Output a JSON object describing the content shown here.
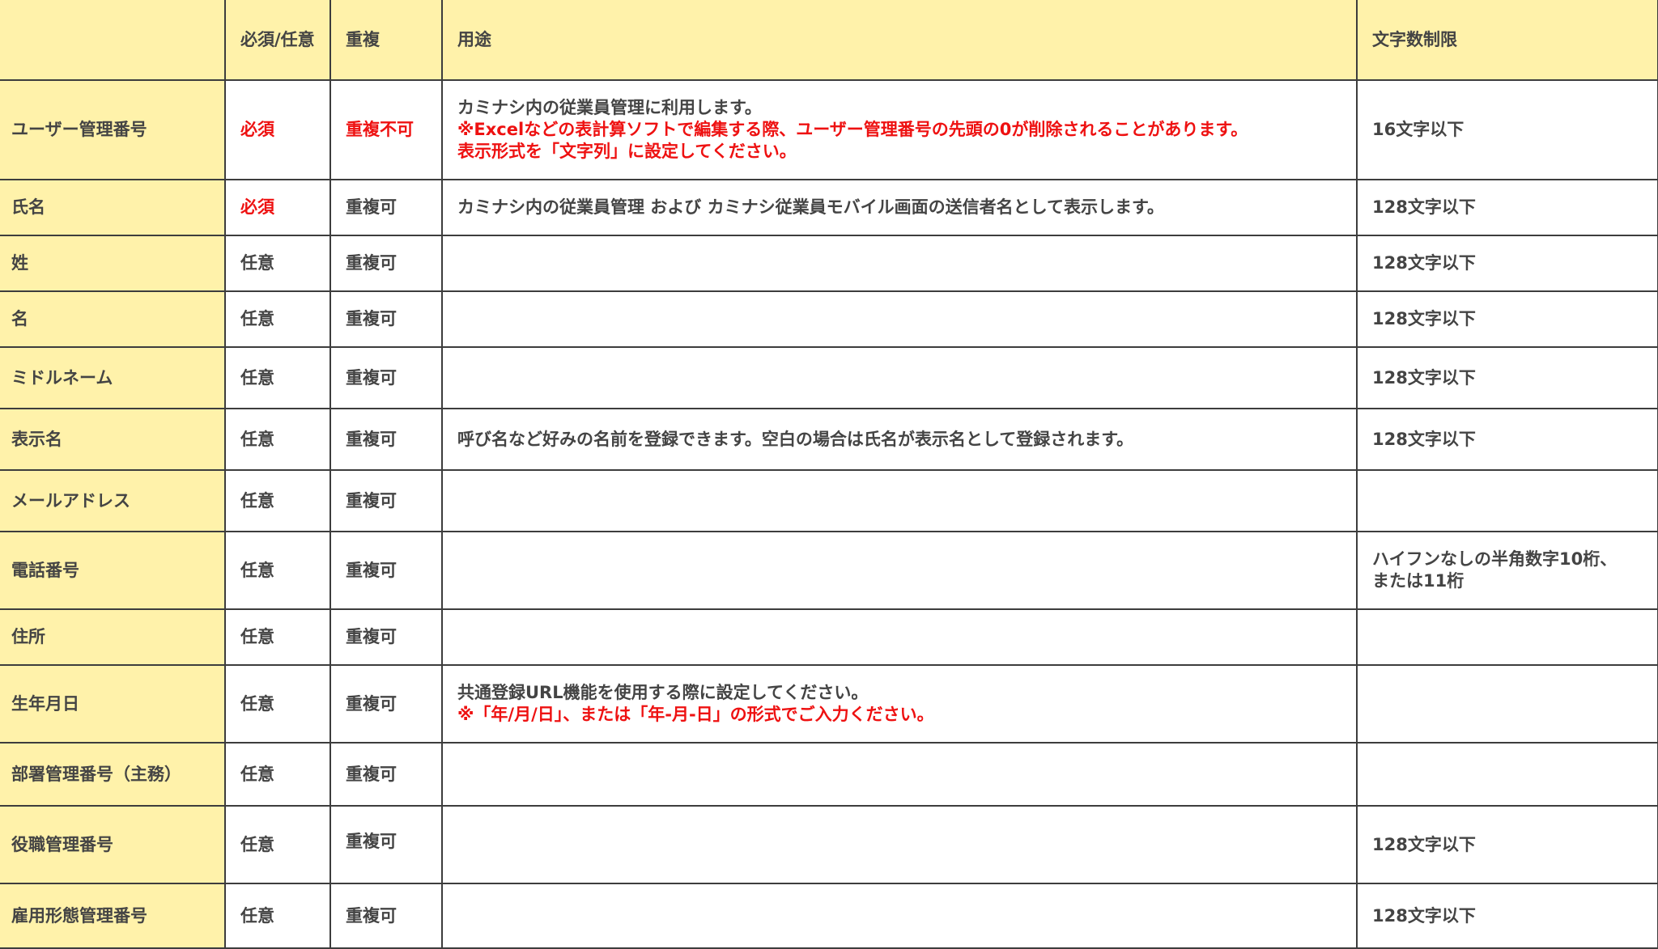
{
  "header": {
    "field": "",
    "required": "必須/任意",
    "duplicate": "重複",
    "purpose": "用途",
    "limit": "文字数制限"
  },
  "rows": [
    {
      "field": "ユーザー管理番号",
      "required": "必須",
      "duplicate": "重複不可",
      "purpose": "カミナシ内の従業員管理に利用します。",
      "purpose_note": "※Excelなどの表計算ソフトで編集する際、ユーザー管理番号の先頭の0が削除されることがあります。",
      "purpose_note2": "表示形式を「文字列」に設定してください。",
      "limit": "16文字以下"
    },
    {
      "field": "氏名",
      "required": "必須",
      "duplicate": "重複可",
      "purpose": "カミナシ内の従業員管理 および カミナシ従業員モバイル画面の送信者名として表示します。",
      "limit": "128文字以下"
    },
    {
      "field": "姓",
      "required": "任意",
      "duplicate": "重複可",
      "purpose": "",
      "limit": "128文字以下"
    },
    {
      "field": "名",
      "required": "任意",
      "duplicate": "重複可",
      "purpose": "",
      "limit": "128文字以下"
    },
    {
      "field": "ミドルネーム",
      "required": "任意",
      "duplicate": "重複可",
      "purpose": "",
      "limit": "128文字以下"
    },
    {
      "field": "表示名",
      "required": "任意",
      "duplicate": "重複可",
      "purpose": "呼び名など好みの名前を登録できます。空白の場合は氏名が表示名として登録されます。",
      "limit": "128文字以下"
    },
    {
      "field": "メールアドレス",
      "required": "任意",
      "duplicate": "重複可",
      "purpose": "",
      "limit": ""
    },
    {
      "field": "電話番号",
      "required": "任意",
      "duplicate": "重複可",
      "purpose": "",
      "limit": "ハイフンなしの半角数字10桁、",
      "limit2": "または11桁"
    },
    {
      "field": "住所",
      "required": "任意",
      "duplicate": "重複可",
      "purpose": "",
      "limit": ""
    },
    {
      "field": "生年月日",
      "required": "任意",
      "duplicate": "重複可",
      "purpose": "共通登録URL機能を使用する際に設定してください。",
      "purpose_note": "※「年/月/日」、または「年-月-日」の形式でご入力ください。",
      "limit": ""
    },
    {
      "field": "部署管理番号（主務）",
      "required": "任意",
      "duplicate": "重複可",
      "purpose": "",
      "limit": ""
    },
    {
      "field": "役職管理番号",
      "required": "任意",
      "duplicate": "重複可",
      "purpose": "",
      "limit": "128文字以下"
    },
    {
      "field": "雇用形態管理番号",
      "required": "任意",
      "duplicate": "重複可",
      "purpose": "",
      "limit": "128文字以下"
    }
  ],
  "colors": {
    "header_bg": "#fff2aa",
    "required_red": "#ee1111",
    "text": "#444444",
    "border": "#3d3d3d"
  }
}
